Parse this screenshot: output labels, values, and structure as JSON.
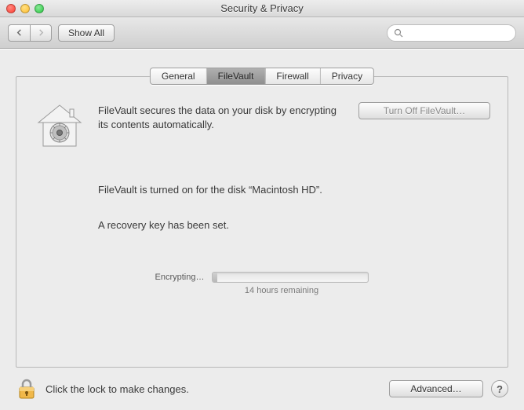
{
  "window": {
    "title": "Security & Privacy"
  },
  "toolbar": {
    "show_all_label": "Show All",
    "search_placeholder": ""
  },
  "tabs": {
    "general": "General",
    "filevault": "FileVault",
    "firewall": "Firewall",
    "privacy": "Privacy",
    "active": "filevault"
  },
  "content": {
    "description": "FileVault secures the data on your disk by encrypting its contents automatically.",
    "turn_off_label": "Turn Off FileVault…",
    "status_on": "FileVault is turned on for the disk “Macintosh HD”.",
    "recovery_key": "A recovery key has been set.",
    "progress_label": "Encrypting…",
    "time_remaining": "14 hours remaining",
    "progress_percent": 3
  },
  "footer": {
    "lock_text": "Click the lock to make changes.",
    "advanced_label": "Advanced…"
  }
}
